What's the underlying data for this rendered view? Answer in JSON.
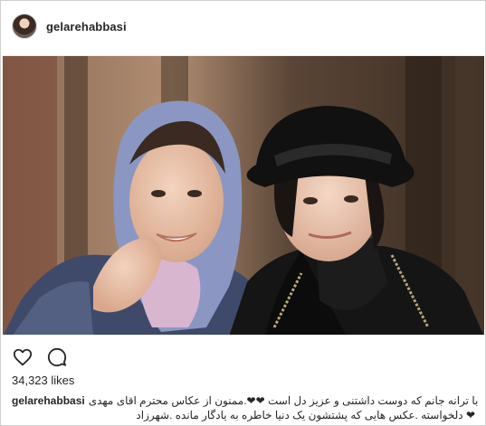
{
  "post": {
    "username": "gelarehabbasi",
    "likes": "34,323 likes",
    "caption": {
      "username": "gelarehabbasi",
      "line1_text": "با ترانه جانم که دوست داشتنی و عزیز دل است ❤❤.ممنون از عکاس محترم اقای مهدی",
      "line2_text": "❤ دلخواسته .عکس هایی که پشتشون یک دنیا خاطره به یادگار مانده .شهرزاد"
    }
  },
  "icons": {
    "like": "heart-outline-icon",
    "comment": "comment-bubble-icon"
  },
  "colors": {
    "text": "#262626",
    "border": "#cfcfcf",
    "heart_emoji": "#e8577a"
  }
}
